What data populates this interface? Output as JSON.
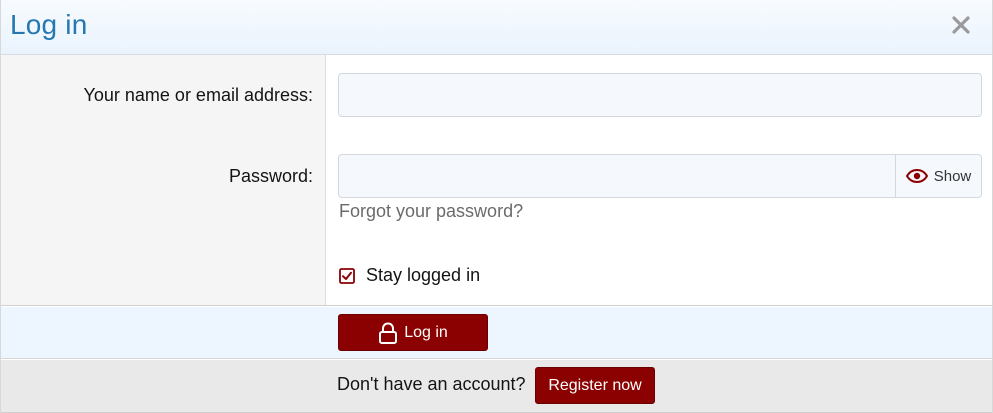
{
  "dialog": {
    "title": "Log in",
    "close_icon": "close-icon"
  },
  "form": {
    "login_label": "Your name or email address:",
    "login_value": "",
    "password_label": "Password:",
    "password_value": "",
    "show_label": "Show",
    "show_icon": "eye-icon",
    "forgot_link": "Forgot your password?",
    "stay_logged_in_label": "Stay logged in",
    "stay_logged_in_checked": true
  },
  "actions": {
    "login_label": "Log in",
    "login_icon": "lock-icon"
  },
  "footer": {
    "text": "Don't have an account?",
    "register_label": "Register now"
  },
  "colors": {
    "accent": "#8b0000",
    "title": "#2577b1",
    "header_bg": "#eaf3fd",
    "label_col_bg": "#f5f5f5",
    "input_bg": "#f5f9fe",
    "footer_bg": "#e9e9e9"
  }
}
